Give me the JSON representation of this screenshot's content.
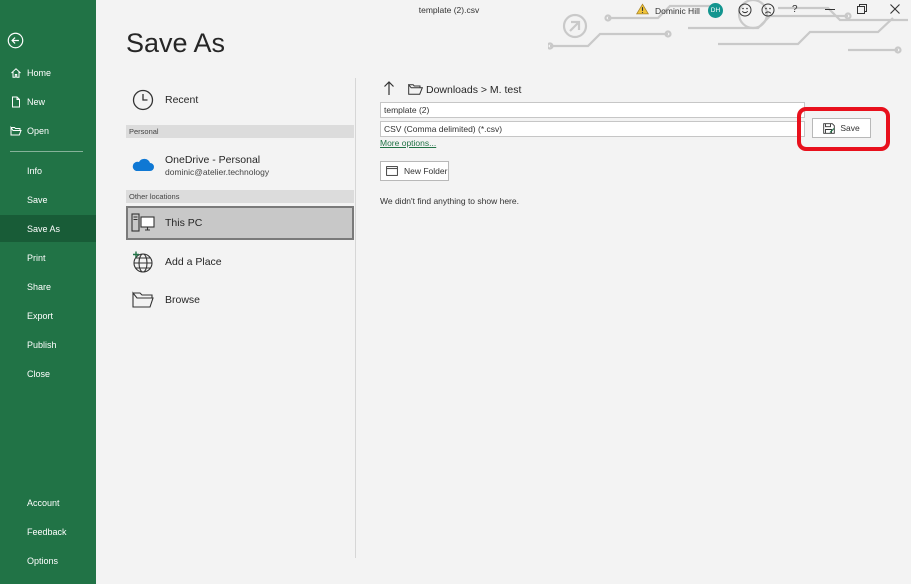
{
  "window": {
    "doc_title": "template (2).csv",
    "user_name": "Dominic Hill",
    "user_initials": "DH",
    "help_label": "?"
  },
  "nav": {
    "items": [
      {
        "label": "Home"
      },
      {
        "label": "New"
      },
      {
        "label": "Open"
      },
      {
        "label": "Info"
      },
      {
        "label": "Save"
      },
      {
        "label": "Save As"
      },
      {
        "label": "Print"
      },
      {
        "label": "Share"
      },
      {
        "label": "Export"
      },
      {
        "label": "Publish"
      },
      {
        "label": "Close"
      },
      {
        "label": "Account"
      },
      {
        "label": "Feedback"
      },
      {
        "label": "Options"
      }
    ],
    "active": "Save As"
  },
  "page": {
    "title": "Save As"
  },
  "locations": {
    "recent": "Recent",
    "personal_header": "Personal",
    "onedrive_name": "OneDrive - Personal",
    "onedrive_email": "dominic@atelier.technology",
    "other_header": "Other locations",
    "this_pc": "This PC",
    "add_place": "Add a Place",
    "browse": "Browse"
  },
  "save_pane": {
    "breadcrumb": "Downloads > M. test",
    "filename": "template (2)",
    "filetype": "CSV (Comma delimited) (*.csv)",
    "more_options": "More options...",
    "save_label": "Save",
    "new_folder_label": "New Folder",
    "empty_message": "We didn't find anything to show here."
  },
  "colors": {
    "accent": "#217346",
    "nav_active": "#185c37",
    "highlight": "#e8101c",
    "avatar": "#13958f"
  }
}
